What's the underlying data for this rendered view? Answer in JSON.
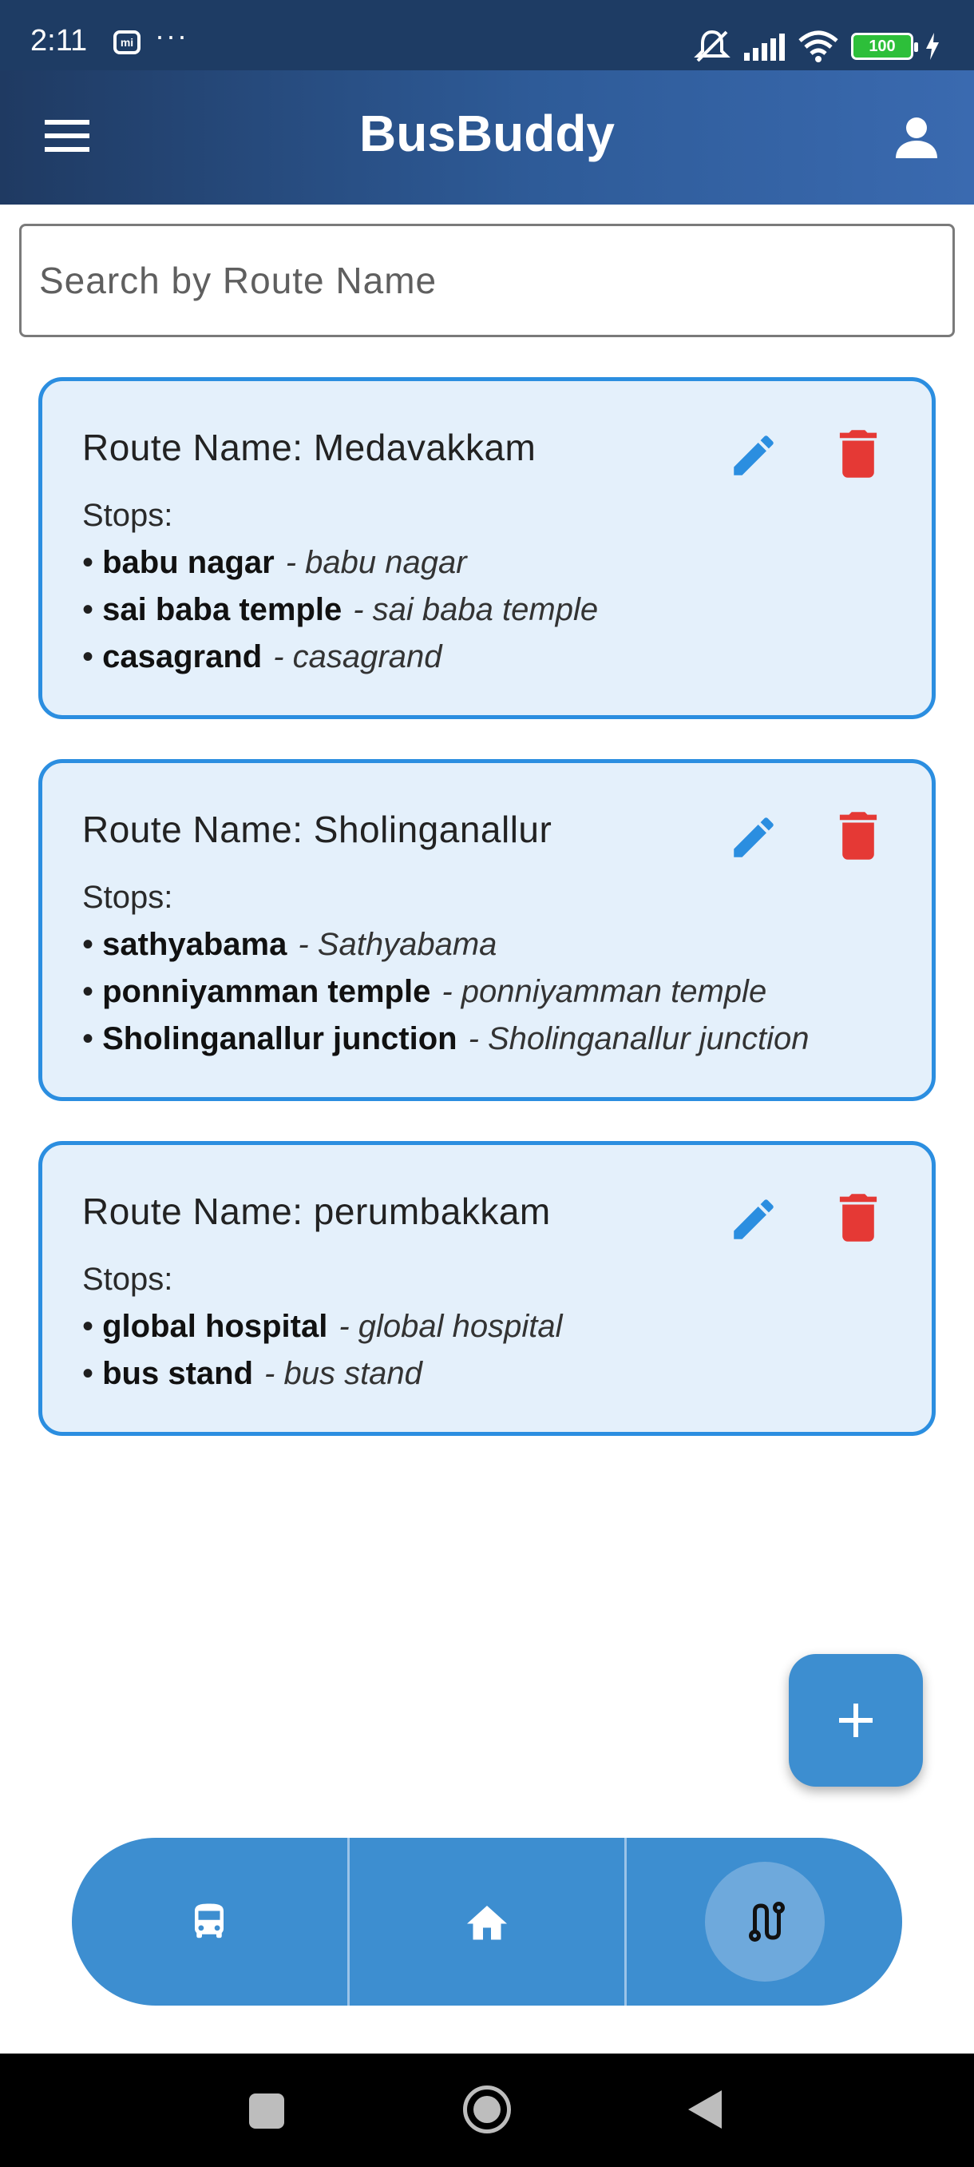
{
  "status_bar": {
    "time": "2:11",
    "notification_icon": "mi-icon",
    "more": "···",
    "battery": "100"
  },
  "app_bar": {
    "title": "BusBuddy",
    "menu_icon": "menu-icon",
    "profile_icon": "profile-icon",
    "background_colors": [
      "#1f3a62",
      "#3a6ab0"
    ]
  },
  "search": {
    "placeholder": "Search by Route Name",
    "value": ""
  },
  "routes": [
    {
      "title": "Route Name: Medavakkam",
      "stops_label": "Stops:",
      "stops": [
        {
          "name": "babu nagar",
          "desc": "- babu nagar"
        },
        {
          "name": "sai baba temple",
          "desc": "- sai baba temple"
        },
        {
          "name": "casagrand",
          "desc": "- casagrand"
        }
      ]
    },
    {
      "title": "Route Name: Sholinganallur",
      "stops_label": "Stops:",
      "stops": [
        {
          "name": "sathyabama",
          "desc": "- Sathyabama"
        },
        {
          "name": "ponniyamman temple",
          "desc": "- ponniyamman temple"
        },
        {
          "name": "Sholinganallur junction",
          "desc": "- Sholinganallur junction"
        }
      ]
    },
    {
      "title": "Route Name: perumbakkam",
      "stops_label": "Stops:",
      "stops": [
        {
          "name": "global hospital",
          "desc": "- global hospital"
        },
        {
          "name": "bus stand",
          "desc": "- bus stand"
        }
      ]
    }
  ],
  "card_actions": {
    "edit_icon": "edit-icon",
    "delete_icon": "delete-icon",
    "edit_color": "#2b8ee0",
    "delete_color": "#e53935"
  },
  "fab": {
    "icon": "plus-icon"
  },
  "bottom_nav": {
    "items": [
      {
        "icon": "bus-icon",
        "active": false
      },
      {
        "icon": "home-icon",
        "active": false
      },
      {
        "icon": "route-icon",
        "active": true
      }
    ],
    "color": "#3d8ed0"
  },
  "system_nav": {
    "items": [
      "recents-button",
      "home-button",
      "back-button"
    ]
  }
}
